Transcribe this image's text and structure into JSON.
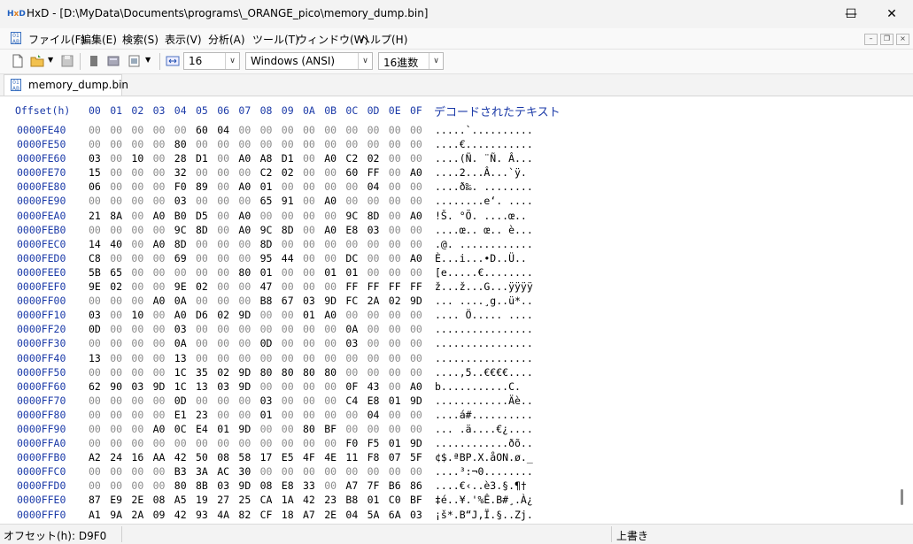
{
  "window": {
    "title": "HxD - [D:\\MyData\\Documents\\programs\\_ORANGE_pico\\memory_dump.bin]",
    "app_icon_text": "HxD",
    "minimize": "—",
    "maximize": "☐",
    "close": "✕"
  },
  "menu": {
    "items": [
      "ファイル(F)",
      "編集(E)",
      "検索(S)",
      "表示(V)",
      "分析(A)",
      "ツール(T)",
      "ウィンドウ(W)",
      "ヘルプ(H)"
    ],
    "mdi_minimize": "–",
    "mdi_restore": "❐",
    "mdi_close": "×"
  },
  "toolbar": {
    "bytes_per_row": "16",
    "charset": "Windows (ANSI)",
    "offset_base": "16進数"
  },
  "tab": {
    "label": "memory_dump.bin"
  },
  "hex_view": {
    "offset_header": "Offset(h)",
    "columns": [
      "00",
      "01",
      "02",
      "03",
      "04",
      "05",
      "06",
      "07",
      "08",
      "09",
      "0A",
      "0B",
      "0C",
      "0D",
      "0E",
      "0F"
    ],
    "decoded_header": "デコードされたテキスト",
    "rows": [
      {
        "offset": "0000FE40",
        "bytes": [
          "00",
          "00",
          "00",
          "00",
          "00",
          "60",
          "04",
          "00",
          "00",
          "00",
          "00",
          "00",
          "00",
          "00",
          "00",
          "00"
        ],
        "text": ".....`.........."
      },
      {
        "offset": "0000FE50",
        "bytes": [
          "00",
          "00",
          "00",
          "00",
          "80",
          "00",
          "00",
          "00",
          "00",
          "00",
          "00",
          "00",
          "00",
          "00",
          "00",
          "00"
        ],
        "text": "....€..........."
      },
      {
        "offset": "0000FE60",
        "bytes": [
          "03",
          "00",
          "10",
          "00",
          "28",
          "D1",
          "00",
          "A0",
          "A8",
          "D1",
          "00",
          "A0",
          "C2",
          "02",
          "00",
          "00"
        ],
        "text": "....(Ñ. ¨Ñ. Â..."
      },
      {
        "offset": "0000FE70",
        "bytes": [
          "15",
          "00",
          "00",
          "00",
          "32",
          "00",
          "00",
          "00",
          "C2",
          "02",
          "00",
          "00",
          "60",
          "FF",
          "00",
          "A0"
        ],
        "text": "....2...Â...`ÿ. "
      },
      {
        "offset": "0000FE80",
        "bytes": [
          "06",
          "00",
          "00",
          "00",
          "F0",
          "89",
          "00",
          "A0",
          "01",
          "00",
          "00",
          "00",
          "00",
          "04",
          "00",
          "00"
        ],
        "text": "....ð‰. ........"
      },
      {
        "offset": "0000FE90",
        "bytes": [
          "00",
          "00",
          "00",
          "00",
          "03",
          "00",
          "00",
          "00",
          "65",
          "91",
          "00",
          "A0",
          "00",
          "00",
          "00",
          "00"
        ],
        "text": "........e‘. ...."
      },
      {
        "offset": "0000FEA0",
        "bytes": [
          "21",
          "8A",
          "00",
          "A0",
          "B0",
          "D5",
          "00",
          "A0",
          "00",
          "00",
          "00",
          "00",
          "9C",
          "8D",
          "00",
          "A0"
        ],
        "text": "!Š. °Õ. ....œ.. "
      },
      {
        "offset": "0000FEB0",
        "bytes": [
          "00",
          "00",
          "00",
          "00",
          "9C",
          "8D",
          "00",
          "A0",
          "9C",
          "8D",
          "00",
          "A0",
          "E8",
          "03",
          "00",
          "00"
        ],
        "text": "....œ.. œ.. è..."
      },
      {
        "offset": "0000FEC0",
        "bytes": [
          "14",
          "40",
          "00",
          "A0",
          "8D",
          "00",
          "00",
          "00",
          "8D",
          "00",
          "00",
          "00",
          "00",
          "00",
          "00",
          "00"
        ],
        "text": ".@. ............"
      },
      {
        "offset": "0000FED0",
        "bytes": [
          "C8",
          "00",
          "00",
          "00",
          "69",
          "00",
          "00",
          "00",
          "95",
          "44",
          "00",
          "00",
          "DC",
          "00",
          "00",
          "A0"
        ],
        "text": "È...i...•D..Ü.. "
      },
      {
        "offset": "0000FEE0",
        "bytes": [
          "5B",
          "65",
          "00",
          "00",
          "00",
          "00",
          "00",
          "80",
          "01",
          "00",
          "00",
          "01",
          "01",
          "00",
          "00",
          "00"
        ],
        "text": "[e.....€........"
      },
      {
        "offset": "0000FEF0",
        "bytes": [
          "9E",
          "02",
          "00",
          "00",
          "9E",
          "02",
          "00",
          "00",
          "47",
          "00",
          "00",
          "00",
          "FF",
          "FF",
          "FF",
          "FF"
        ],
        "text": "ž...ž...G...ÿÿÿÿ"
      },
      {
        "offset": "0000FF00",
        "bytes": [
          "00",
          "00",
          "00",
          "A0",
          "0A",
          "00",
          "00",
          "00",
          "B8",
          "67",
          "03",
          "9D",
          "FC",
          "2A",
          "02",
          "9D"
        ],
        "text": "... ....¸g..ü*.."
      },
      {
        "offset": "0000FF10",
        "bytes": [
          "03",
          "00",
          "10",
          "00",
          "A0",
          "D6",
          "02",
          "9D",
          "00",
          "00",
          "01",
          "A0",
          "00",
          "00",
          "00",
          "00"
        ],
        "text": ".... Ö..... ...."
      },
      {
        "offset": "0000FF20",
        "bytes": [
          "0D",
          "00",
          "00",
          "00",
          "03",
          "00",
          "00",
          "00",
          "00",
          "00",
          "00",
          "00",
          "0A",
          "00",
          "00",
          "00"
        ],
        "text": "................"
      },
      {
        "offset": "0000FF30",
        "bytes": [
          "00",
          "00",
          "00",
          "00",
          "0A",
          "00",
          "00",
          "00",
          "0D",
          "00",
          "00",
          "00",
          "03",
          "00",
          "00",
          "00"
        ],
        "text": "................"
      },
      {
        "offset": "0000FF40",
        "bytes": [
          "13",
          "00",
          "00",
          "00",
          "13",
          "00",
          "00",
          "00",
          "00",
          "00",
          "00",
          "00",
          "00",
          "00",
          "00",
          "00"
        ],
        "text": "................"
      },
      {
        "offset": "0000FF50",
        "bytes": [
          "00",
          "00",
          "00",
          "00",
          "1C",
          "35",
          "02",
          "9D",
          "80",
          "80",
          "80",
          "80",
          "00",
          "00",
          "00",
          "00"
        ],
        "text": "....,5..€€€€...."
      },
      {
        "offset": "0000FF60",
        "bytes": [
          "62",
          "90",
          "03",
          "9D",
          "1C",
          "13",
          "03",
          "9D",
          "00",
          "00",
          "00",
          "00",
          "0F",
          "43",
          "00",
          "A0"
        ],
        "text": "b...........C. "
      },
      {
        "offset": "0000FF70",
        "bytes": [
          "00",
          "00",
          "00",
          "00",
          "0D",
          "00",
          "00",
          "00",
          "03",
          "00",
          "00",
          "00",
          "C4",
          "E8",
          "01",
          "9D"
        ],
        "text": "............Äè.."
      },
      {
        "offset": "0000FF80",
        "bytes": [
          "00",
          "00",
          "00",
          "00",
          "E1",
          "23",
          "00",
          "00",
          "01",
          "00",
          "00",
          "00",
          "00",
          "04",
          "00",
          "00"
        ],
        "text": "....á#.........."
      },
      {
        "offset": "0000FF90",
        "bytes": [
          "00",
          "00",
          "00",
          "A0",
          "0C",
          "E4",
          "01",
          "9D",
          "00",
          "00",
          "80",
          "BF",
          "00",
          "00",
          "00",
          "00"
        ],
        "text": "... .ä....€¿...."
      },
      {
        "offset": "0000FFA0",
        "bytes": [
          "00",
          "00",
          "00",
          "00",
          "00",
          "00",
          "00",
          "00",
          "00",
          "00",
          "00",
          "00",
          "F0",
          "F5",
          "01",
          "9D"
        ],
        "text": "............ðõ.."
      },
      {
        "offset": "0000FFB0",
        "bytes": [
          "A2",
          "24",
          "16",
          "AA",
          "42",
          "50",
          "08",
          "58",
          "17",
          "E5",
          "4F",
          "4E",
          "11",
          "F8",
          "07",
          "5F"
        ],
        "text": "¢$.ªBP.X.åON.ø._"
      },
      {
        "offset": "0000FFC0",
        "bytes": [
          "00",
          "00",
          "00",
          "00",
          "B3",
          "3A",
          "AC",
          "30",
          "00",
          "00",
          "00",
          "00",
          "00",
          "00",
          "00",
          "00"
        ],
        "text": "....³:¬0........"
      },
      {
        "offset": "0000FFD0",
        "bytes": [
          "00",
          "00",
          "00",
          "00",
          "80",
          "8B",
          "03",
          "9D",
          "08",
          "E8",
          "33",
          "00",
          "A7",
          "7F",
          "B6",
          "86"
        ],
        "text": "....€‹..è3.§.¶†"
      },
      {
        "offset": "0000FFE0",
        "bytes": [
          "87",
          "E9",
          "2E",
          "08",
          "A5",
          "19",
          "27",
          "25",
          "CA",
          "1A",
          "42",
          "23",
          "B8",
          "01",
          "C0",
          "BF"
        ],
        "text": "‡é..¥.'%Ê.B#¸.À¿"
      },
      {
        "offset": "0000FFF0",
        "bytes": [
          "A1",
          "9A",
          "2A",
          "09",
          "42",
          "93",
          "4A",
          "82",
          "CF",
          "18",
          "A7",
          "2E",
          "04",
          "5A",
          "6A",
          "03"
        ],
        "text": "¡š*.B“J‚Ï.§..Zj."
      }
    ]
  },
  "status": {
    "offset": "オフセット(h): D9F0",
    "mode": "上書き"
  }
}
